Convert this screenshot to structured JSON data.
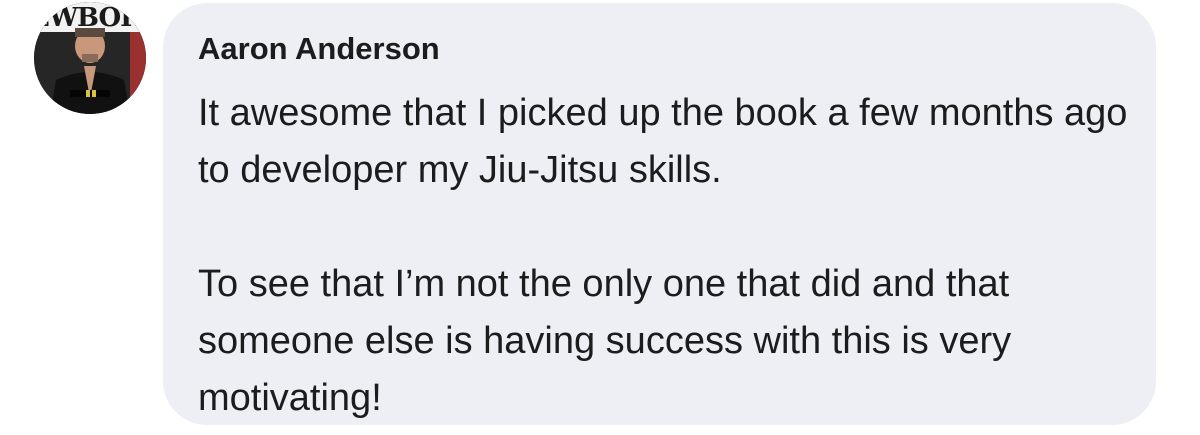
{
  "comment": {
    "avatar_icon": "profile-photo",
    "avatar_logo_text": "EWBOR",
    "author": "Aaron Anderson",
    "paragraphs": [
      "It awesome that I picked up the book a few months ago to developer my Jiu-Jitsu skills.",
      "To see that I’m not the only one that did and that someone else is having success with this is very motivating!"
    ]
  },
  "colors": {
    "bubble_background": "#eeeff4",
    "text": "#1c1c1e",
    "page_background": "#ffffff"
  }
}
